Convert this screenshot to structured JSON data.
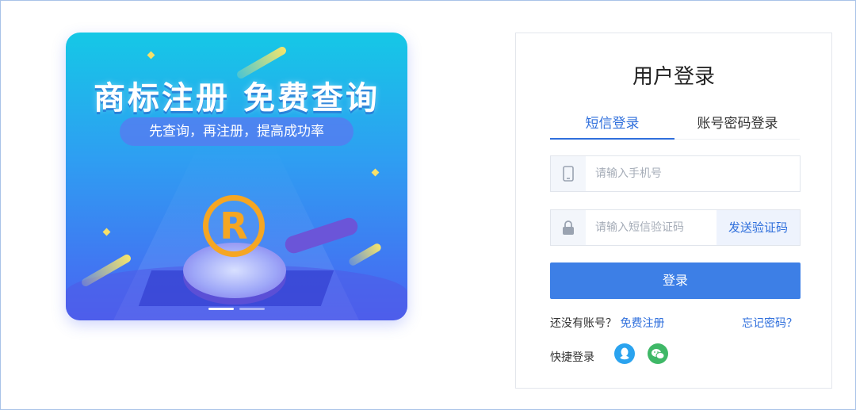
{
  "banner": {
    "title": "商标注册  免费查询",
    "subtitle": "先查询，再注册，提高成功率",
    "logo_letter": "R",
    "slide_count": 2,
    "active_slide": 1
  },
  "login": {
    "title": "用户登录",
    "tabs": [
      {
        "label": "短信登录",
        "active": true
      },
      {
        "label": "账号密码登录",
        "active": false
      }
    ],
    "phone_placeholder": "请输入手机号",
    "code_placeholder": "请输入短信验证码",
    "send_code_label": "发送验证码",
    "submit_label": "登录",
    "no_account_text": "还没有账号？",
    "register_link": "免费注册",
    "forgot_link": "忘记密码？",
    "quick_login_label": "快捷登录",
    "social": [
      {
        "icon": "qq-icon",
        "color": "#2aa3ef"
      },
      {
        "icon": "wechat-icon",
        "color": "#3fb867"
      }
    ]
  },
  "colors": {
    "accent": "#3d7fe6",
    "link": "#2f6fdc",
    "logo_gold": "#f5a623"
  }
}
